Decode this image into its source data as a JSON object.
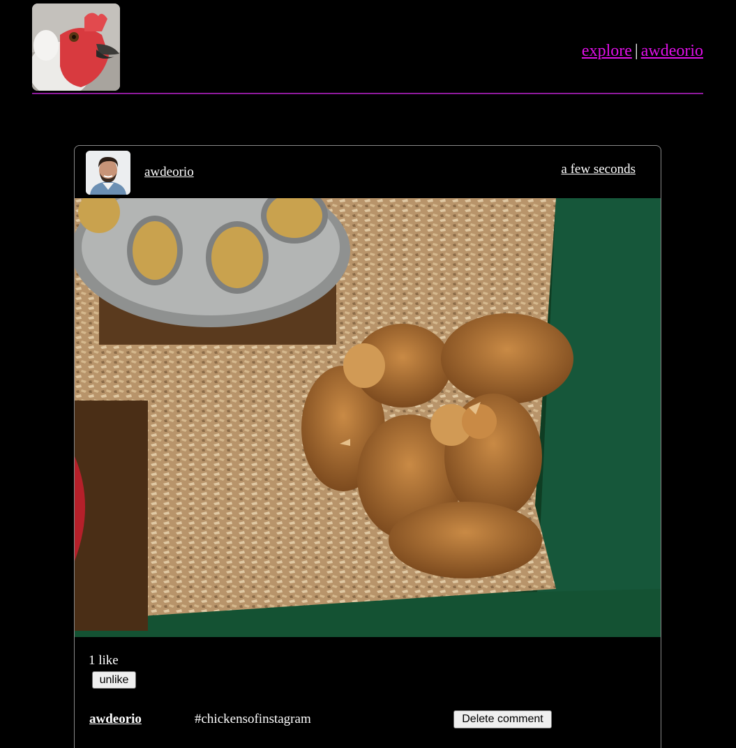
{
  "header": {
    "logo_icon": "chicken-logo-icon",
    "nav": {
      "explore_label": "explore",
      "separator": "|",
      "user_label": "awdeorio"
    },
    "accent_color": "#e010e8",
    "divider_color": "#8e1a9c"
  },
  "post": {
    "owner_avatar_icon": "owner-avatar-photo",
    "owner": "awdeorio",
    "timestamp": "a few seconds",
    "photo_description_icon": "chicks-in-brooder-photo",
    "likes_text": "1 like",
    "like_button_label": "unlike",
    "comments": [
      {
        "owner": "awdeorio",
        "text": "#chickensofinstagram",
        "delete_label": "Delete comment"
      }
    ]
  }
}
